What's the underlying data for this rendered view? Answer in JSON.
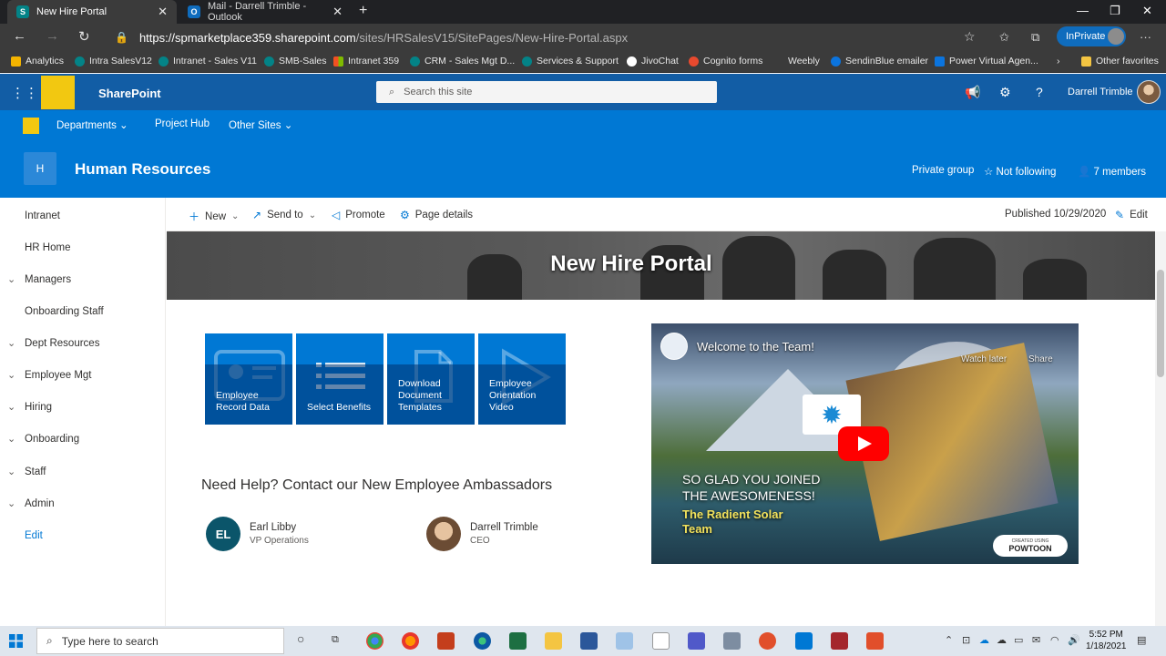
{
  "browser": {
    "tabs": [
      {
        "title": "New Hire Portal",
        "favicon": "S",
        "active": true
      },
      {
        "title": "Mail - Darrell Trimble - Outlook",
        "favicon": "O",
        "active": false
      }
    ],
    "url_host": "https://spmarketplace359.sharepoint.com",
    "url_path": "/sites/HRSalesV15/SitePages/New-Hire-Portal.aspx",
    "inprivate_label": "InPrivate",
    "favorites": [
      "Analytics",
      "Intra SalesV12",
      "Intranet - Sales V11",
      "SMB-Sales",
      "Intranet 359",
      "CRM - Sales Mgt D...",
      "Services & Support",
      "JivoChat",
      "Cognito forms",
      "Weebly",
      "SendinBlue emailer",
      "Power Virtual Agen...",
      "Other favorites"
    ]
  },
  "suite": {
    "app_name": "SharePoint",
    "search_placeholder": "Search this site",
    "user_name": "Darrell Trimble"
  },
  "hub": {
    "items": [
      "Departments",
      "Project Hub",
      "Other Sites"
    ]
  },
  "site": {
    "logo_letter": "H",
    "title": "Human Resources",
    "privacy": "Private group",
    "follow": "Not following",
    "members": "7 members"
  },
  "leftnav": {
    "items": [
      {
        "label": "Intranet",
        "expandable": false
      },
      {
        "label": "HR Home",
        "expandable": false
      },
      {
        "label": "Managers",
        "expandable": true
      },
      {
        "label": "Onboarding Staff",
        "expandable": false
      },
      {
        "label": "Dept Resources",
        "expandable": true
      },
      {
        "label": "Employee Mgt",
        "expandable": true
      },
      {
        "label": "Hiring",
        "expandable": true
      },
      {
        "label": "Onboarding",
        "expandable": true
      },
      {
        "label": "Staff",
        "expandable": true
      },
      {
        "label": "Admin",
        "expandable": true
      },
      {
        "label": "Edit",
        "expandable": false
      }
    ]
  },
  "commandbar": {
    "new": "New",
    "send_to": "Send to",
    "promote": "Promote",
    "page_details": "Page details",
    "published": "Published 10/29/2020",
    "edit": "Edit"
  },
  "page": {
    "banner_title": "New Hire Portal",
    "tiles": [
      {
        "label": "Employee Record Data",
        "icon": "id-card-icon"
      },
      {
        "label": "Select Benefits",
        "icon": "list-icon"
      },
      {
        "label": "Download Document Templates",
        "icon": "document-icon"
      },
      {
        "label": "Employee Orientation Video",
        "icon": "play-icon"
      }
    ],
    "help_title": "Need Help? Contact our New Employee Ambassadors",
    "people": [
      {
        "initials": "EL",
        "name": "Earl Libby",
        "title": "VP Operations"
      },
      {
        "initials": "",
        "name": "Darrell Trimble",
        "title": "CEO"
      }
    ],
    "video": {
      "title": "Welcome to the Team!",
      "watch_later": "Watch later",
      "share": "Share",
      "text_line1": "SO GLAD YOU JOINED",
      "text_line2": "THE AWESOMENESS!",
      "text_line3": "The Radient Solar",
      "text_line4": "Team",
      "badge_small": "CREATED USING",
      "badge_brand": "POWTOON"
    }
  },
  "taskbar": {
    "search_placeholder": "Type here to search",
    "time": "5:52 PM",
    "date": "1/18/2021"
  }
}
